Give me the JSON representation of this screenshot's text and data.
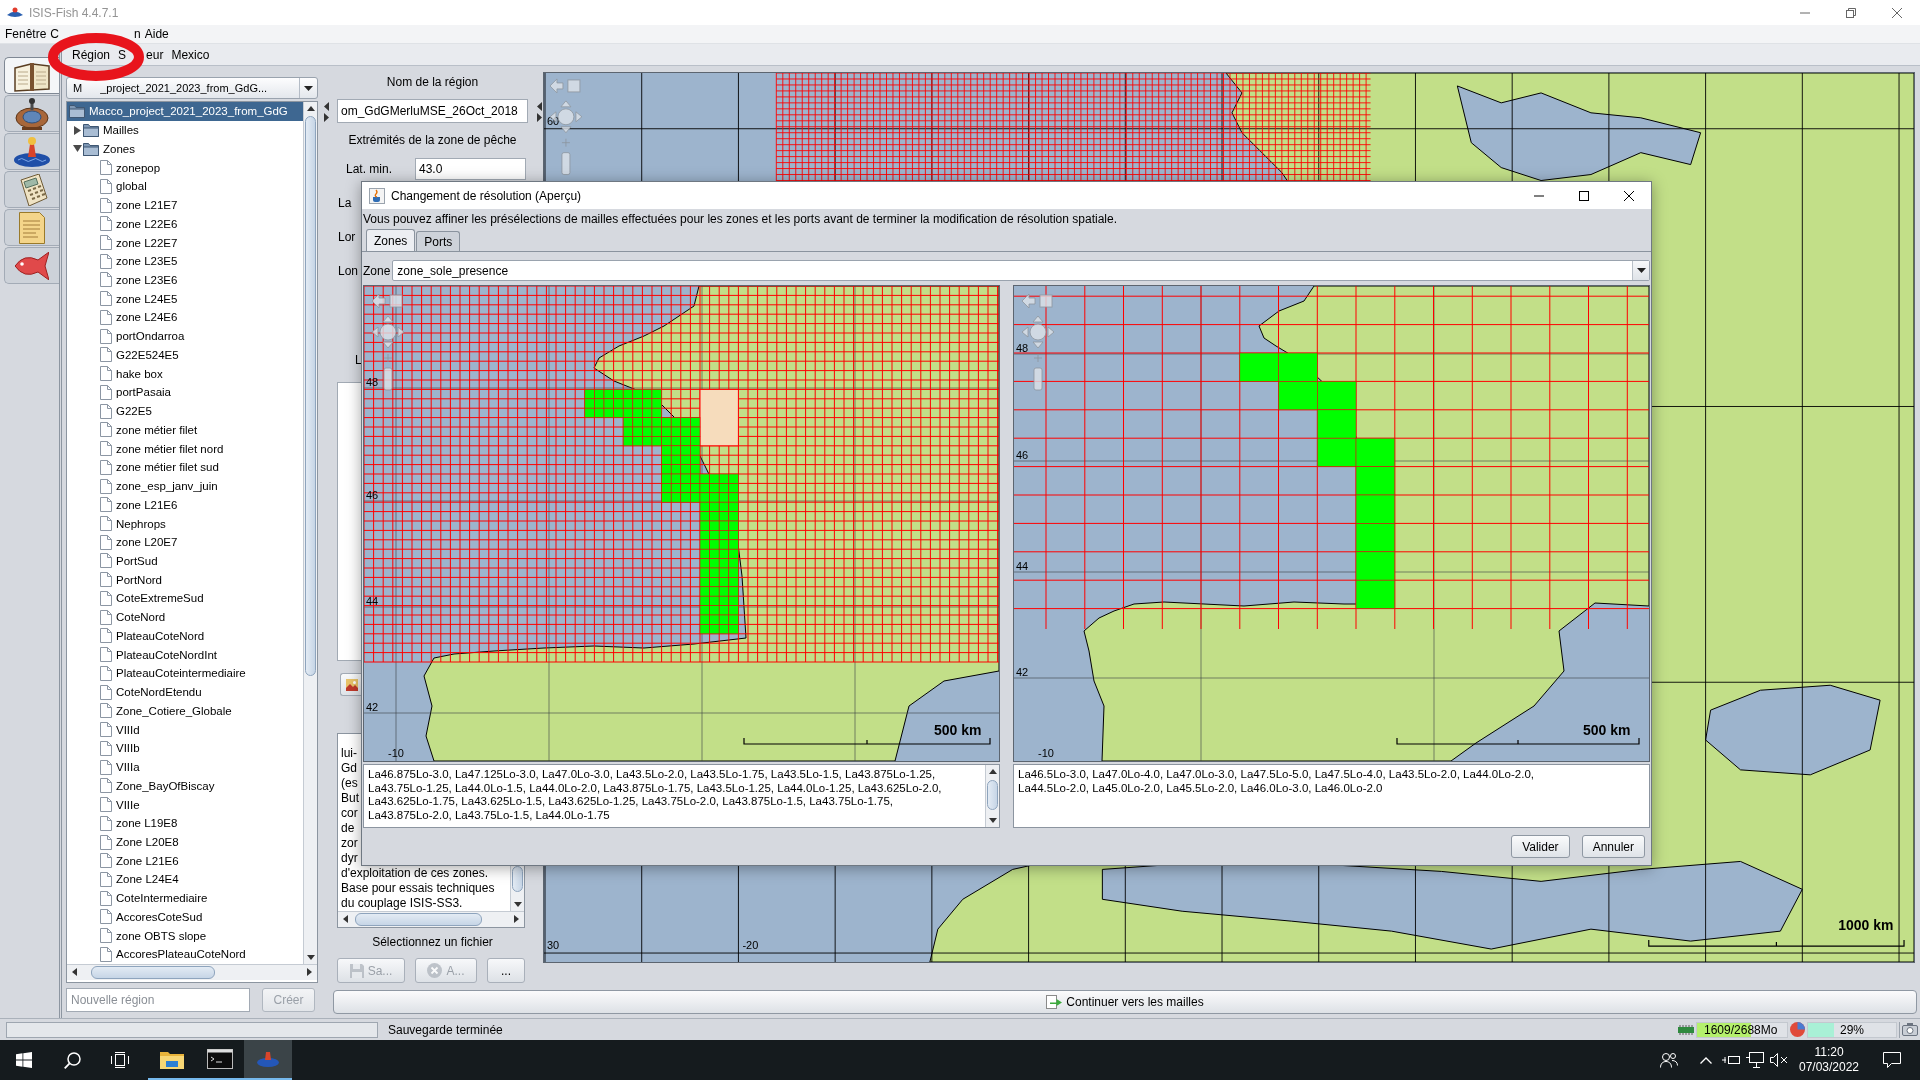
{
  "window": {
    "title": "ISIS-Fish 4.4.7.1"
  },
  "menu_bar": [
    {
      "parts": [
        "Fenêtre"
      ]
    },
    {
      "parts": [
        "C",
        "n"
      ]
    },
    {
      "parts": [
        "Aide"
      ]
    }
  ],
  "annotations": [
    {
      "kind": "ring"
    }
  ],
  "side_tools": [
    {
      "kind": "book",
      "selected": true
    },
    {
      "kind": "sphere",
      "selected": false
    },
    {
      "kind": "boat",
      "selected": false
    },
    {
      "kind": "calculator",
      "selected": false
    },
    {
      "kind": "document",
      "selected": false
    },
    {
      "kind": "fish",
      "selected": false
    }
  ],
  "region_menu": [
    {
      "parts": [
        "Région"
      ]
    },
    {
      "parts": [
        "S",
        "eur"
      ]
    },
    {
      "parts": [
        "Mexico"
      ]
    }
  ],
  "region_panel": {
    "region_combo": {
      "parts": [
        "M",
        "_project_2021_2023_from_GdG..."
      ]
    },
    "tree": [
      {
        "label": "Macco_project_2021_2023_from_GdG",
        "kind": "folder",
        "selected": true,
        "children": [
          {
            "label": "Mailles",
            "kind": "folder",
            "selected": false,
            "expanded": false
          },
          {
            "label": "Zones",
            "kind": "folder",
            "selected": false,
            "expanded": true,
            "children": [
              {
                "label": "zonepop",
                "kind": "file",
                "selected": false
              },
              {
                "label": "global",
                "kind": "file",
                "selected": false
              },
              {
                "label": "zone L21E7",
                "kind": "file",
                "selected": false
              },
              {
                "label": "zone L22E6",
                "kind": "file",
                "selected": false
              },
              {
                "label": "zone L22E7",
                "kind": "file",
                "selected": false
              },
              {
                "label": "zone L23E5",
                "kind": "file",
                "selected": false
              },
              {
                "label": "zone L23E6",
                "kind": "file",
                "selected": false
              },
              {
                "label": "zone L24E5",
                "kind": "file",
                "selected": false
              },
              {
                "label": "zone L24E6",
                "kind": "file",
                "selected": false
              },
              {
                "label": "portOndarroa",
                "kind": "file",
                "selected": false
              },
              {
                "label": "G22E524E5",
                "kind": "file",
                "selected": false
              },
              {
                "label": "hake box",
                "kind": "file",
                "selected": false
              },
              {
                "label": "portPasaia",
                "kind": "file",
                "selected": false
              },
              {
                "label": "G22E5",
                "kind": "file",
                "selected": false
              },
              {
                "label": "zone métier filet",
                "kind": "file",
                "selected": false
              },
              {
                "label": "zone métier filet nord",
                "kind": "file",
                "selected": false
              },
              {
                "label": "zone métier filet sud",
                "kind": "file",
                "selected": false
              },
              {
                "label": "zone_esp_janv_juin",
                "kind": "file",
                "selected": false
              },
              {
                "label": "zone L21E6",
                "kind": "file",
                "selected": false
              },
              {
                "label": "Nephrops",
                "kind": "file",
                "selected": false
              },
              {
                "label": "zone L20E7",
                "kind": "file",
                "selected": false
              },
              {
                "label": "PortSud",
                "kind": "file",
                "selected": false
              },
              {
                "label": "PortNord",
                "kind": "file",
                "selected": false
              },
              {
                "label": "CoteExtremeSud",
                "kind": "file",
                "selected": false
              },
              {
                "label": "CoteNord",
                "kind": "file",
                "selected": false
              },
              {
                "label": "PlateauCoteNord",
                "kind": "file",
                "selected": false
              },
              {
                "label": "PlateauCoteNordInt",
                "kind": "file",
                "selected": false
              },
              {
                "label": "PlateauCoteintermediaire",
                "kind": "file",
                "selected": false
              },
              {
                "label": "CoteNordEtendu",
                "kind": "file",
                "selected": false
              },
              {
                "label": "Zone_Cotiere_Globale",
                "kind": "file",
                "selected": false
              },
              {
                "label": "VIIId",
                "kind": "file",
                "selected": false
              },
              {
                "label": "VIIIb",
                "kind": "file",
                "selected": false
              },
              {
                "label": "VIIIa",
                "kind": "file",
                "selected": false
              },
              {
                "label": "Zone_BayOfBiscay",
                "kind": "file",
                "selected": false
              },
              {
                "label": "VIIIe",
                "kind": "file",
                "selected": false
              },
              {
                "label": "zone L19E8",
                "kind": "file",
                "selected": false
              },
              {
                "label": "Zone L20E8",
                "kind": "file",
                "selected": false
              },
              {
                "label": "Zone L21E6",
                "kind": "file",
                "selected": false
              },
              {
                "label": "Zone L24E4",
                "kind": "file",
                "selected": false
              },
              {
                "label": "CoteIntermediaire",
                "kind": "file",
                "selected": false
              },
              {
                "label": "AccoresCoteSud",
                "kind": "file",
                "selected": false
              },
              {
                "label": "zone OBTS slope",
                "kind": "file",
                "selected": false
              },
              {
                "label": "AccoresPlateauCoteNord",
                "kind": "file",
                "selected": false
              }
            ]
          }
        ]
      }
    ],
    "new_region": {
      "placeholder": "Nouvelle région"
    },
    "create_button": {
      "label": "Créer",
      "disabled": true
    }
  },
  "details_panel": {
    "region_name": {
      "label": "Nom de la région",
      "value": "om_GdGMerluMSE_26Oct_2018"
    },
    "extent_title": "Extrémités de la zone de pêche",
    "coordinate_fields": [
      {
        "label": "Lat. min.",
        "value": "43.0"
      },
      {
        "label": "La"
      },
      {
        "label": "Lor"
      },
      {
        "label": "Lon"
      }
    ],
    "partial_label": "L",
    "description_lines": [
      "lui-",
      "Gd",
      "(es",
      "But",
      "cor",
      "de",
      "zor",
      "dyr",
      "d'exploitation de ces zones.",
      "Base pour essais techniques",
      "du couplage ISIS-SS3."
    ],
    "file_label": "Sélectionnez un fichier",
    "file_buttons": [
      {
        "label": "Sa...",
        "kind": "save",
        "disabled": true
      },
      {
        "label": "A...",
        "kind": "cancel",
        "disabled": true
      },
      {
        "label": "...",
        "kind": "browse",
        "disabled": false
      }
    ]
  },
  "map_panel": {
    "lat_labels": [
      "60",
      "30"
    ],
    "lon_labels": [
      "-20"
    ],
    "scale": "1000 km"
  },
  "continue_button": {
    "label": "Continuer vers les mailles"
  },
  "dialog": {
    "title": "Changement de résolution (Aperçu)",
    "message": "Vous pouvez affiner les présélections de mailles effectuées pour les zones et les ports avant de terminer la modification de résolution spatiale.",
    "tabs": [
      {
        "label": "Zones",
        "selected": true
      },
      {
        "label": "Ports",
        "selected": false
      }
    ],
    "zone_select": {
      "label": "Zone",
      "value": "zone_sole_presence"
    },
    "previews": [
      {
        "kind": "fine",
        "lat_labels": [
          "48",
          "46",
          "44",
          "42"
        ],
        "lon_label": "-10",
        "scale": "500 km",
        "cells": "La46.875Lo-3.0, La47.125Lo-3.0, La47.0Lo-3.0, La43.5Lo-2.0, La43.5Lo-1.75, La43.5Lo-1.5, La43.875Lo-1.25, La43.75Lo-1.25, La44.0Lo-1.5, La44.0Lo-2.0, La43.875Lo-1.75, La43.5Lo-1.25, La44.0Lo-1.25, La43.625Lo-2.0, La43.625Lo-1.75, La43.625Lo-1.5, La43.625Lo-1.25, La43.75Lo-2.0, La43.875Lo-1.5, La43.75Lo-1.75, La43.875Lo-2.0, La43.75Lo-1.5, La44.0Lo-1.75"
      },
      {
        "kind": "coarse",
        "lat_labels": [
          "48",
          "46",
          "44",
          "42"
        ],
        "lon_label": "-10",
        "scale": "500 km",
        "cells": "La46.5Lo-3.0, La47.0Lo-4.0, La47.0Lo-3.0, La47.5Lo-5.0, La47.5Lo-4.0, La43.5Lo-2.0, La44.0Lo-2.0, La44.5Lo-2.0, La45.0Lo-2.0, La45.5Lo-2.0, La46.0Lo-3.0, La46.0Lo-2.0"
      }
    ],
    "buttons": [
      {
        "label": "Valider"
      },
      {
        "label": "Annuler"
      }
    ]
  },
  "status_bar": {
    "progress": {
      "level": 0
    },
    "message": "Sauvegarde terminée",
    "memory": {
      "reading": "1609/2688Mo",
      "level": 0.6
    },
    "cpu": {
      "reading": "29%",
      "level": 0.29
    }
  },
  "taskbar": {
    "apps": [
      {
        "kind": "explorer",
        "focused": false
      },
      {
        "kind": "terminal",
        "focused": false
      },
      {
        "kind": "isis",
        "focused": true
      }
    ],
    "time": "11:20",
    "date": "07/03/2022"
  }
}
